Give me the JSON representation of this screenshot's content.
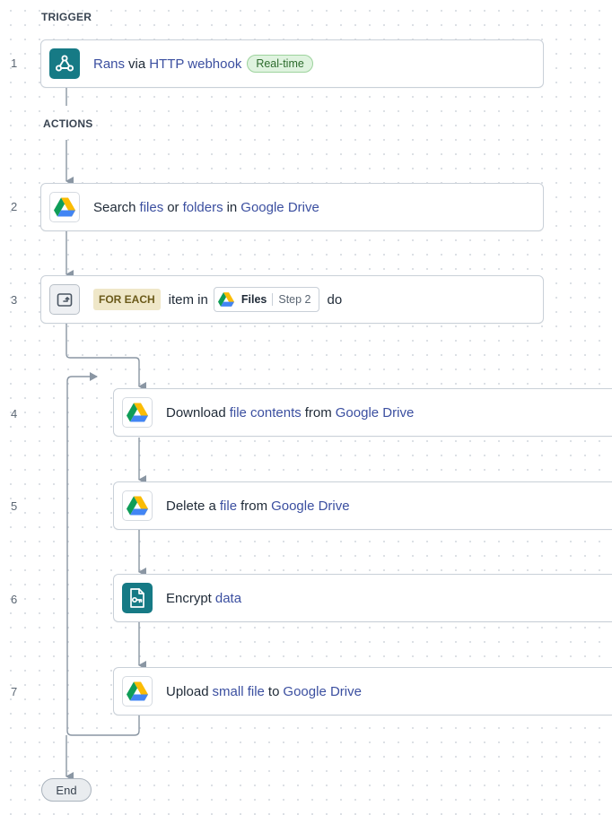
{
  "sections": {
    "trigger": "TRIGGER",
    "actions": "ACTIONS"
  },
  "steps": [
    {
      "num": "1",
      "parts": [
        {
          "t": "Rans",
          "hl": true
        },
        {
          "t": "via",
          "hl": false
        },
        {
          "t": "HTTP webhook",
          "hl": true
        }
      ],
      "badge": "Real-time",
      "icon": "webhook-icon"
    },
    {
      "num": "2",
      "parts": [
        {
          "t": "Search",
          "hl": false
        },
        {
          "t": "files",
          "hl": true
        },
        {
          "t": "or",
          "hl": false
        },
        {
          "t": "folders",
          "hl": true
        },
        {
          "t": "in",
          "hl": false
        },
        {
          "t": "Google Drive",
          "hl": true
        }
      ],
      "icon": "google-drive-icon"
    },
    {
      "num": "3",
      "foreach": "FOR EACH",
      "item_in": "item in",
      "pill_title": "Files",
      "pill_step": "Step 2",
      "do": "do",
      "icon": "loop-icon"
    },
    {
      "num": "4",
      "parts": [
        {
          "t": "Download",
          "hl": false
        },
        {
          "t": "file contents",
          "hl": true
        },
        {
          "t": "from",
          "hl": false
        },
        {
          "t": "Google Drive",
          "hl": true
        }
      ],
      "icon": "google-drive-icon"
    },
    {
      "num": "5",
      "parts": [
        {
          "t": "Delete a",
          "hl": false
        },
        {
          "t": "file",
          "hl": true
        },
        {
          "t": "from",
          "hl": false
        },
        {
          "t": "Google Drive",
          "hl": true
        }
      ],
      "icon": "google-drive-icon"
    },
    {
      "num": "6",
      "parts": [
        {
          "t": "Encrypt",
          "hl": false
        },
        {
          "t": "data",
          "hl": true
        }
      ],
      "icon": "encrypt-file-icon"
    },
    {
      "num": "7",
      "parts": [
        {
          "t": "Upload",
          "hl": false
        },
        {
          "t": "small file",
          "hl": true
        },
        {
          "t": "to",
          "hl": false
        },
        {
          "t": "Google Drive",
          "hl": true
        }
      ],
      "icon": "google-drive-icon"
    }
  ],
  "end_label": "End",
  "colors": {
    "accent_text": "#3b4fa0",
    "teal": "#167a85",
    "connector": "#8a96a3"
  }
}
